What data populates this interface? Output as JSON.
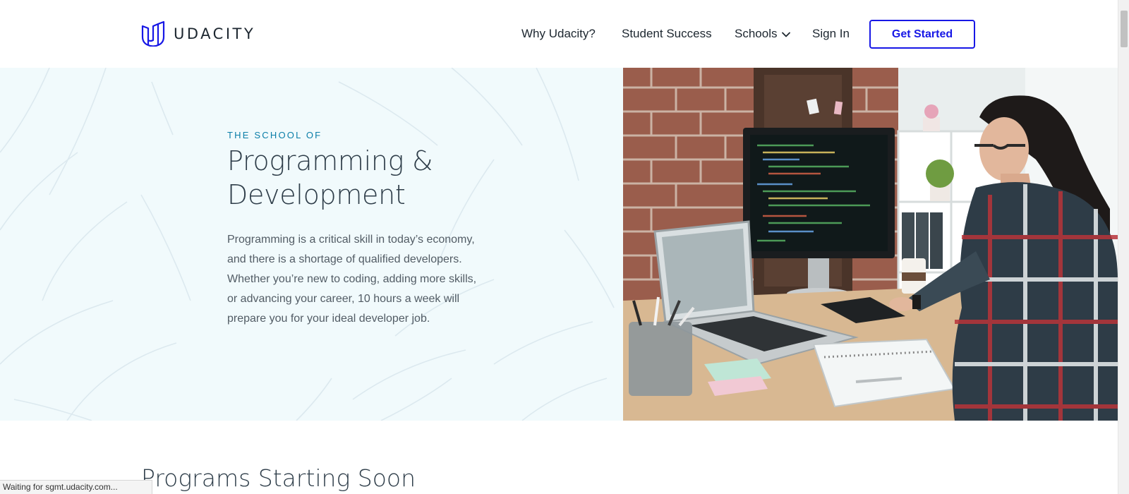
{
  "header": {
    "logo_text": "UDACITY",
    "logo_icon": "udacity-u-logo",
    "nav": {
      "why": "Why Udacity?",
      "success": "Student Success",
      "schools": "Schools",
      "signin": "Sign In"
    },
    "schools_icon": "chevron-down-icon",
    "cta_label": "Get Started"
  },
  "hero": {
    "eyebrow": "THE SCHOOL OF",
    "title_line1": "Programming &",
    "title_line2": "Development",
    "description": "Programming is a critical skill in today’s economy, and there is a shortage of qualified developers. Whether you’re new to coding, adding more skills, or advancing your career, 10 hours a week will prepare you for your ideal developer job.",
    "image_alt": "Developer coding at a desk with a monitor and laptop"
  },
  "programs": {
    "title": "Programs Starting Soon"
  },
  "browser": {
    "status_text": "Waiting for sgmt.udacity.com..."
  },
  "colors": {
    "brand_blue": "#1717e6",
    "eyebrow_teal": "#0a7ea8",
    "hero_bg": "#f1fafc",
    "text_dark": "#2e3d49",
    "text_body": "#525c65"
  }
}
